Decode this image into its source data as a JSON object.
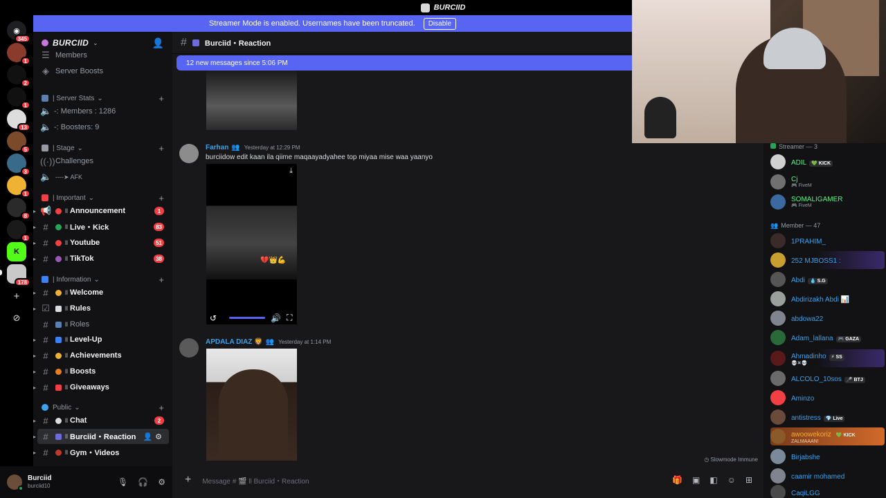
{
  "window": {
    "title": "BURCIID"
  },
  "banner": {
    "text": "Streamer Mode is enabled. Usernames have been truncated.",
    "button": "Disable"
  },
  "rail": {
    "badges": [
      "345",
      "1",
      "2",
      "1",
      "13",
      "5",
      "3",
      "1",
      "8",
      "1",
      "178"
    ]
  },
  "server": {
    "name": "BURCIID"
  },
  "sidebar": {
    "rows": [
      {
        "type": "channel",
        "icon": "members-icon",
        "label": "Members"
      },
      {
        "type": "channel",
        "icon": "boost-icon",
        "label": "Server Boosts"
      },
      {
        "type": "category",
        "label": "| Server Stats"
      },
      {
        "type": "voice",
        "label": "-: Members : 1286"
      },
      {
        "type": "voice",
        "label": "-: Boosters: 9"
      },
      {
        "type": "category",
        "label": "| Stage"
      },
      {
        "type": "stage",
        "label": "Challenges"
      },
      {
        "type": "voice",
        "label": "----➤ AFK"
      },
      {
        "type": "category",
        "label": "| Important"
      },
      {
        "type": "channel",
        "label": "Announcement",
        "badge": "1"
      },
      {
        "type": "channel",
        "label": "Live・Kick",
        "badge": "83"
      },
      {
        "type": "channel",
        "label": "Youtube",
        "badge": "51"
      },
      {
        "type": "channel",
        "label": "TikTok",
        "badge": "38"
      },
      {
        "type": "category",
        "label": "| Information"
      },
      {
        "type": "channel",
        "label": "Welcome"
      },
      {
        "type": "channel",
        "label": "Rules"
      },
      {
        "type": "channel",
        "label": "Roles"
      },
      {
        "type": "channel",
        "label": "Level-Up"
      },
      {
        "type": "channel",
        "label": "Achievements"
      },
      {
        "type": "channel",
        "label": "Boosts"
      },
      {
        "type": "channel",
        "label": "Giveaways"
      },
      {
        "type": "category",
        "label": "Public"
      },
      {
        "type": "channel",
        "label": "Chat",
        "badge": "2"
      },
      {
        "type": "channel",
        "label": "Burciid・Reaction",
        "selected": true
      },
      {
        "type": "channel",
        "label": "Gym・Videos"
      }
    ]
  },
  "user": {
    "name": "Burciid",
    "tag": "burciid10"
  },
  "channel": {
    "title": "Burciid・Reaction"
  },
  "newMessages": "12 new messages since 5:06 PM",
  "messages": [
    {
      "author": "Farhan",
      "time": "Yesterday at 12:29 PM",
      "text": "burciidow edit kaan ila qiime maqaayadyahee top miyaa mise waa yaanyo",
      "overlay": "💔👑💪"
    },
    {
      "author": "APDALA DIAZ 🦁",
      "time": "Yesterday at 1:14 PM",
      "text": ""
    }
  ],
  "slowmode": "Slowmode Immune",
  "composer": {
    "placeholder": "Message # 🎬 ll Burciid・Reaction"
  },
  "members": {
    "groups": [
      {
        "title": "Streamer — 3",
        "items": [
          {
            "name": "ADIL",
            "tag": "💚 KICK",
            "color": "green"
          },
          {
            "name": "Cj",
            "sub": "🎮 FiveM",
            "color": "green"
          },
          {
            "name": "SOMALIGAMER",
            "sub": "🎮 FiveM",
            "color": "green"
          }
        ]
      },
      {
        "title": "Member — 47",
        "items": [
          {
            "name": "1PRAHIM_"
          },
          {
            "name": "252 MJBOSS1 :"
          },
          {
            "name": "Abdi",
            "tag": "💧 S.G"
          },
          {
            "name": "Abdirizakh Abdi 📊"
          },
          {
            "name": "abdowa22"
          },
          {
            "name": "Adam_lallana",
            "tag": "🎮 GAZA"
          },
          {
            "name": "Ahmadinho",
            "tag": "⚡ SS",
            "sub": "💀✖💀"
          },
          {
            "name": "ALCOLO_10sos",
            "tag": "🎤 BTJ"
          },
          {
            "name": "Aminzo"
          },
          {
            "name": "antistress",
            "tag": "💎 Live"
          },
          {
            "name": "awoowekoriz",
            "tag": "💚 KICK",
            "sub": "ZALMAAAN!",
            "color": "orange"
          },
          {
            "name": "Birjabshe"
          },
          {
            "name": "caamir mohamed"
          },
          {
            "name": "CaqiLGG"
          }
        ]
      }
    ]
  },
  "colors": {
    "blurple": "#5865f2",
    "link": "#3ba2ed",
    "green": "#57f287",
    "red": "#f23f43"
  }
}
